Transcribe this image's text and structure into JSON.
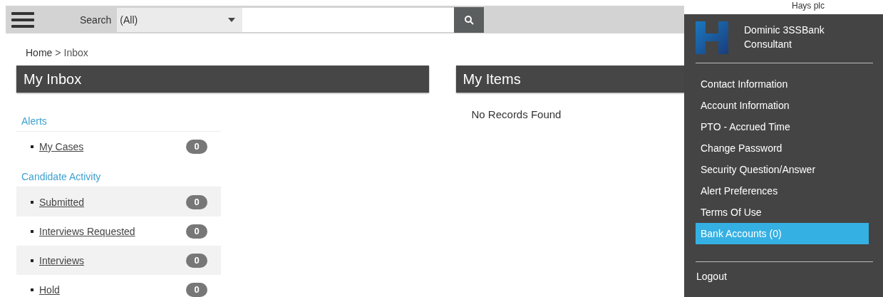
{
  "top_bar": {
    "search_label": "Search",
    "search_scope": "(All)",
    "company": "Hays plc"
  },
  "breadcrumb": [
    {
      "label": "Home",
      "kind": "link"
    },
    {
      "label": ">",
      "kind": "separator"
    },
    {
      "label": "Inbox",
      "kind": "current"
    }
  ],
  "inbox": {
    "title": "My Inbox",
    "sections": [
      {
        "title": "Alerts",
        "items": [
          {
            "label": "My Cases",
            "count": "0"
          }
        ]
      },
      {
        "title": "Candidate Activity",
        "items": [
          {
            "label": "Submitted",
            "count": "0"
          },
          {
            "label": "Interviews Requested",
            "count": "0"
          },
          {
            "label": "Interviews",
            "count": "0"
          },
          {
            "label": "Hold",
            "count": "0"
          }
        ]
      }
    ]
  },
  "my_items": {
    "title": "My Items",
    "empty_text": "No Records Found"
  },
  "user_menu": {
    "name": "Dominic 3SSBank",
    "role": "Consultant",
    "items": [
      {
        "label": "Contact Information",
        "selected": false
      },
      {
        "label": "Account Information",
        "selected": false
      },
      {
        "label": "PTO - Accrued Time",
        "selected": false
      },
      {
        "label": "Change Password",
        "selected": false
      },
      {
        "label": "Security Question/Answer",
        "selected": false
      },
      {
        "label": "Alert Preferences",
        "selected": false
      },
      {
        "label": "Terms Of Use",
        "selected": false
      },
      {
        "label": "Bank Accounts (0)",
        "selected": true
      }
    ],
    "logout": "Logout"
  }
}
